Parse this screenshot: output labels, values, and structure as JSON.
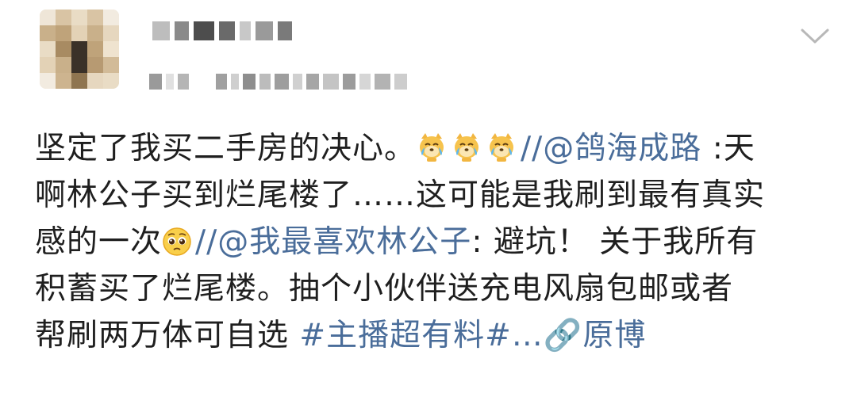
{
  "post": {
    "lines": [
      [
        {
          "t": "text",
          "v": "坚定了我买二手房的决心。"
        },
        {
          "t": "emoji",
          "v": "doge-tears-icon"
        },
        {
          "t": "emoji",
          "v": "doge-tears-icon"
        },
        {
          "t": "emoji",
          "v": "doge-tears-icon"
        },
        {
          "t": "text",
          "v": "//",
          "link": true
        },
        {
          "t": "text",
          "v": "@鸽海成路",
          "link": true
        },
        {
          "t": "text",
          "v": " :天"
        }
      ],
      [
        {
          "t": "text",
          "v": "啊林公子买到烂尾楼了……这可能是我刷到最有真实"
        }
      ],
      [
        {
          "t": "text",
          "v": "感的一次"
        },
        {
          "t": "emoji",
          "v": "pleading-face-icon"
        },
        {
          "t": "text",
          "v": "//",
          "link": true
        },
        {
          "t": "text",
          "v": "@我最喜欢林公子",
          "link": true
        },
        {
          "t": "text",
          "v": ": 避坑！ 关于我所有"
        }
      ],
      [
        {
          "t": "text",
          "v": "积蓄买了烂尾楼。抽个小伙伴送充电风扇包邮或者"
        }
      ],
      [
        {
          "t": "text",
          "v": "帮刷两万体可自选 "
        },
        {
          "t": "text",
          "v": "#主播超有料#…",
          "link": true
        },
        {
          "t": "text",
          "v": "🔗原博",
          "link": true
        }
      ]
    ]
  },
  "colors": {
    "link": "#4a6d9a",
    "text": "#1f1f1f",
    "chevron": "#b8b8b8"
  },
  "icons": {
    "menu": "chevron-down-icon"
  }
}
